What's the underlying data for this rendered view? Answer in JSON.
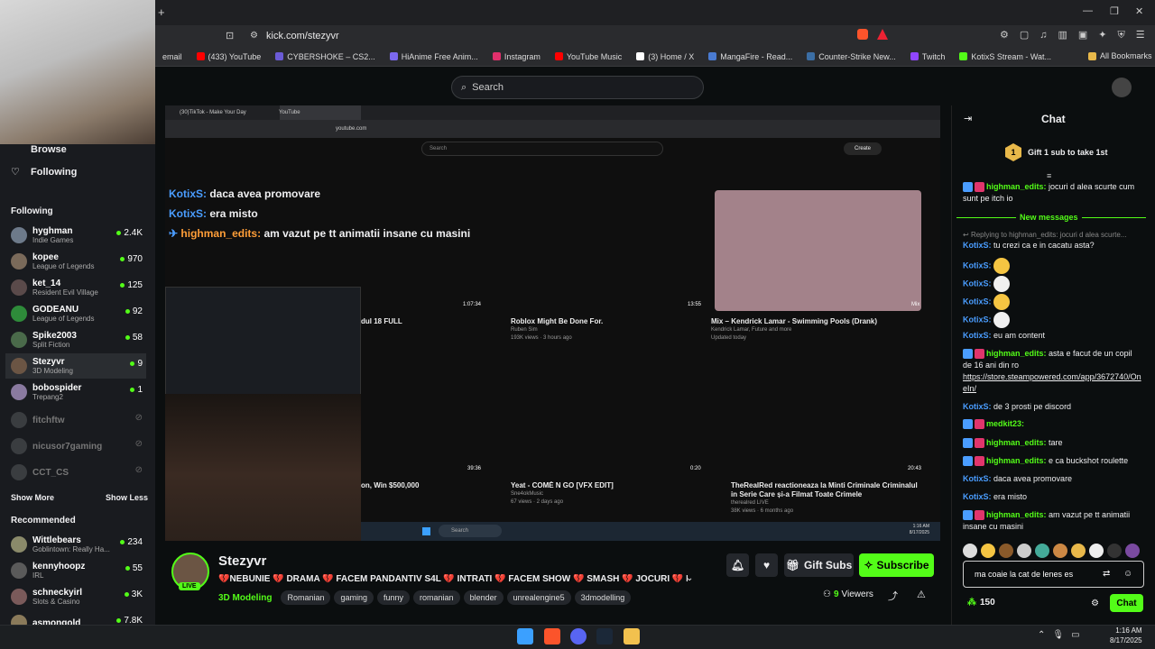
{
  "browser": {
    "url": "kick.com/stezyvr",
    "bookmarks": [
      {
        "label": "email",
        "color": "#888888"
      },
      {
        "label": "(433) YouTube",
        "color": "#ff0000"
      },
      {
        "label": "CYBERSHOKE – CS2...",
        "color": "#6b5bd6"
      },
      {
        "label": "HiAnime Free Anim...",
        "color": "#7b68ee"
      },
      {
        "label": "Instagram",
        "color": "#e1306c"
      },
      {
        "label": "YouTube Music",
        "color": "#ff0000"
      },
      {
        "label": "(3) Home / X",
        "color": "#ffffff"
      },
      {
        "label": "MangaFire - Read...",
        "color": "#4a7bd1"
      },
      {
        "label": "Counter-Strike New...",
        "color": "#3b6ea5"
      },
      {
        "label": "Twitch",
        "color": "#9146ff"
      },
      {
        "label": "KotixS Stream - Wat...",
        "color": "#53fc18"
      }
    ],
    "all_bookmarks": "All Bookmarks"
  },
  "header": {
    "search_placeholder": "Search"
  },
  "sidebar": {
    "browse": "Browse",
    "following_nav": "Following",
    "following_header": "Following",
    "following": [
      {
        "name": "hyghman",
        "game": "Indie Games",
        "count": "2.4K",
        "color": "#6d7a8a"
      },
      {
        "name": "kopee",
        "game": "League of Legends",
        "count": "970",
        "color": "#7a6a5a"
      },
      {
        "name": "ket_14",
        "game": "Resident Evil Village",
        "count": "125",
        "color": "#5a4a4a"
      },
      {
        "name": "GODEANU",
        "game": "League of Legends",
        "count": "92",
        "color": "#2e8b3a"
      },
      {
        "name": "Spike2003",
        "game": "Split Fiction",
        "count": "58",
        "color": "#4a6a4a"
      },
      {
        "name": "Stezyvr",
        "game": "3D Modeling",
        "count": "9",
        "color": "#6b5544"
      },
      {
        "name": "bobospider",
        "game": "Trepang2",
        "count": "1",
        "color": "#8a7aa0"
      }
    ],
    "offline": [
      {
        "name": "fitchftw"
      },
      {
        "name": "nicusor7gaming"
      },
      {
        "name": "CCT_CS"
      }
    ],
    "show_more": "Show More",
    "show_less": "Show Less",
    "recommended_header": "Recommended",
    "recommended": [
      {
        "name": "Wittlebears",
        "game": "Goblintown: Really Ha...",
        "count": "234",
        "color": "#8a8a6a"
      },
      {
        "name": "kennyhoopz",
        "game": "IRL",
        "count": "55",
        "color": "#5a5a5a"
      },
      {
        "name": "schneckyirl",
        "game": "Slots & Casino",
        "count": "3K",
        "color": "#7a5a5a"
      },
      {
        "name": "asmongold",
        "game": "",
        "count": "7.8K",
        "color": "#8a7a5a"
      }
    ]
  },
  "video": {
    "inner_tabs": [
      "(30)TikTok - Make Your Day",
      "YouTube"
    ],
    "inner_url": "youtube.com",
    "inner_search": "Search",
    "inner_create": "Create",
    "overlay_chat": [
      {
        "user": "KotixS:",
        "text": "daca avea promovare",
        "style": "blue"
      },
      {
        "user": "KotixS:",
        "text": "era misto",
        "style": "blue"
      },
      {
        "user": "highman_edits:",
        "text": "am vazut pe tt animatii insane cu masini",
        "style": "orange"
      }
    ],
    "videos": [
      {
        "title": "dul 18 FULL",
        "channel": "",
        "meta": "",
        "duration": "1:07:34"
      },
      {
        "title": "Roblox Might Be Done For.",
        "channel": "Ruben Sim",
        "meta": "193K views · 3 hours ago",
        "duration": "13:55"
      },
      {
        "title": "Mix – Kendrick Lamar - Swimming Pools (Drank)",
        "channel": "Kendrick Lamar, Future and more",
        "meta": "Updated today",
        "duration": "Mix"
      },
      {
        "title": "on, Win $500,000",
        "channel": "",
        "meta": "",
        "duration": "39:36"
      },
      {
        "title": "Yeat - COMĖ N GO [VFX EDIT]",
        "channel": "Sne4okMusic",
        "meta": "67 views · 2 days ago",
        "duration": "0:20"
      },
      {
        "title": "TheRealRed reactioneaza la Minti Criminale Criminalul in Serie Care și-a Filmat Toate Crimele",
        "channel": "therealred LIVE",
        "meta": "38K views · 6 months ago",
        "duration": "20:43"
      }
    ],
    "inner_search_taskbar": "Search",
    "inner_clock_time": "1:16 AM",
    "inner_clock_date": "8/17/2025"
  },
  "stream": {
    "streamer": "Stezyvr",
    "live": "LIVE",
    "title": "💔NEBUNIE 💔 DRAMA 💔 FACEM PANDANTIV S4L 💔 INTRATI 💔 FACEM SHOW 💔 SMASH 💔 JOCURI 💔 ROAD TO ...",
    "category": "3D Modeling",
    "tags": [
      "Romanian",
      "gaming",
      "funny",
      "romanian",
      "blender",
      "unrealengine5",
      "3dmodelling"
    ],
    "viewers": "9",
    "viewers_label": "Viewers",
    "gift_subs": "Gift Subs",
    "subscribe": "Subscribe"
  },
  "chat": {
    "title": "Chat",
    "gift_badge": "1",
    "gift_text": "Gift 1 sub to take 1st",
    "new_messages": "New messages",
    "messages": [
      {
        "user": "highman_edits:",
        "style": "green",
        "text": "jocuri d alea scurte cum sunt pe itch io",
        "badges": true
      },
      {
        "user": "",
        "style": "reply",
        "text": "Replying to highman_edits: jocuri d alea scurte..."
      },
      {
        "user": "KotixS:",
        "style": "blue",
        "text": "tu crezi ca e in  cacatu asta?"
      },
      {
        "user": "KotixS:",
        "style": "blue",
        "text": "",
        "emote": "#f5c542"
      },
      {
        "user": "KotixS:",
        "style": "blue",
        "text": "",
        "emote": "#f0f0f0"
      },
      {
        "user": "KotixS:",
        "style": "blue",
        "text": "",
        "emote": "#f5c542"
      },
      {
        "user": "KotixS:",
        "style": "blue",
        "text": "",
        "emote": "#f0f0f0"
      },
      {
        "user": "KotixS:",
        "style": "blue",
        "text": "eu am content"
      },
      {
        "user": "highman_edits:",
        "style": "green",
        "text": "asta e facut de un copil de 16 ani din ro",
        "badges": true
      },
      {
        "user": "",
        "style": "link",
        "text": "https://store.steampowered.com/app/3672740/OneIn/"
      },
      {
        "user": "KotixS:",
        "style": "blue",
        "text": "de 3 prosti pe discord"
      },
      {
        "user": "medkit23:",
        "style": "green",
        "text": "",
        "badges": true
      },
      {
        "user": "highman_edits:",
        "style": "green",
        "text": "tare",
        "badges": true
      },
      {
        "user": "highman_edits:",
        "style": "green",
        "text": "e ca buckshot roulette",
        "badges": true
      },
      {
        "user": "KotixS:",
        "style": "blue",
        "text": "daca avea promovare"
      },
      {
        "user": "KotixS:",
        "style": "blue",
        "text": "era misto"
      },
      {
        "user": "highman_edits:",
        "style": "green",
        "text": "am vazut pe tt animatii insane cu masini",
        "badges": true
      }
    ],
    "input_value": "ma coaie la cat de lenes es",
    "points": "150",
    "send": "Chat"
  },
  "os": {
    "time": "1:16 AM",
    "date": "8/17/2025"
  },
  "colors": {
    "kick_green": "#53fc18",
    "user_blue": "#4a9dff",
    "user_orange": "#ff9e38"
  }
}
